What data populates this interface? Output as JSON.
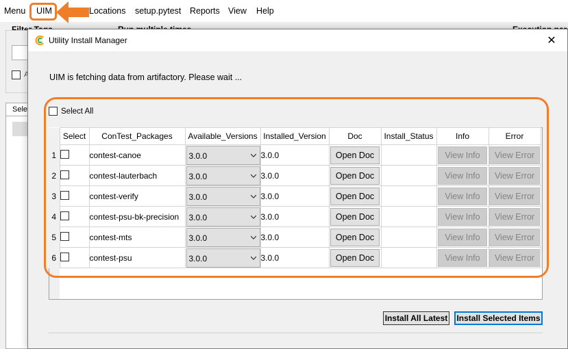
{
  "menubar": {
    "items": [
      "Menu",
      "UIM",
      "Locations",
      "setup.pytest",
      "Reports",
      "View",
      "Help"
    ]
  },
  "background": {
    "filter_label": "Filter Tags",
    "run_label": "Run multiple times",
    "exec_label": "Execution para",
    "checkbox_label": "A",
    "tab_label": "Selec"
  },
  "dialog": {
    "title": "Utility Install Manager",
    "close_glyph": "✕",
    "status_message": "UIM is fetching data from artifactory. Please wait ...",
    "select_all_label": "Select All",
    "columns": [
      "Select",
      "ConTest_Packages",
      "Available_Versions",
      "Installed_Version",
      "Doc",
      "Install_Status",
      "Info",
      "Error"
    ],
    "rows": [
      {
        "num": "1",
        "package": "contest-canoe",
        "available": "3.0.0",
        "installed": "3.0.0",
        "doc": "Open Doc",
        "status": "",
        "info": "View Info",
        "error": "View Error"
      },
      {
        "num": "2",
        "package": "contest-lauterbach",
        "available": "3.0.0",
        "installed": "3.0.0",
        "doc": "Open Doc",
        "status": "",
        "info": "View Info",
        "error": "View Error"
      },
      {
        "num": "3",
        "package": "contest-verify",
        "available": "3.0.0",
        "installed": "3.0.0",
        "doc": "Open Doc",
        "status": "",
        "info": "View Info",
        "error": "View Error"
      },
      {
        "num": "4",
        "package": "contest-psu-bk-precision",
        "available": "3.0.0",
        "installed": "3.0.0",
        "doc": "Open Doc",
        "status": "",
        "info": "View Info",
        "error": "View Error"
      },
      {
        "num": "5",
        "package": "contest-mts",
        "available": "3.0.0",
        "installed": "3.0.0",
        "doc": "Open Doc",
        "status": "",
        "info": "View Info",
        "error": "View Error"
      },
      {
        "num": "6",
        "package": "contest-psu",
        "available": "3.0.0",
        "installed": "3.0.0",
        "doc": "Open Doc",
        "status": "",
        "info": "View Info",
        "error": "View Error"
      }
    ],
    "install_all_label": "Install All Latest",
    "install_selected_label": "Install Selected Items"
  },
  "colors": {
    "highlight": "#f07d28",
    "primary_button_border": "#0078d7",
    "disabled_button": "#cccccc"
  }
}
